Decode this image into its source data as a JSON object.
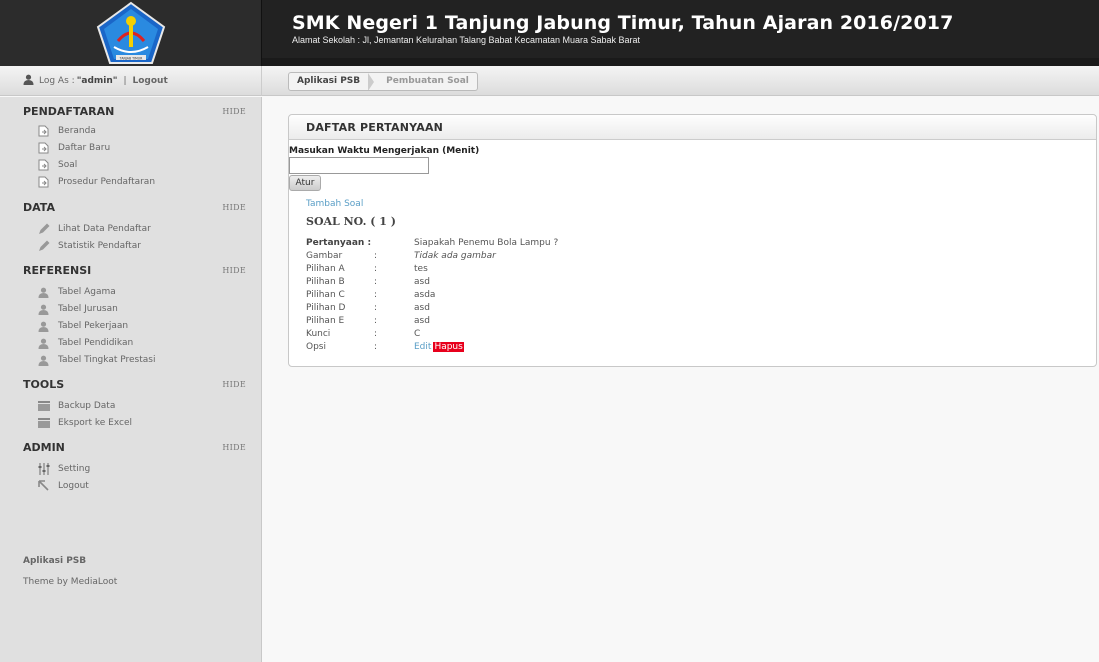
{
  "header": {
    "title": "SMK Negeri 1 Tanjung Jabung Timur, Tahun Ajaran 2016/2017",
    "subtitle": "Alamat Sekolah : Jl, Jemantan Kelurahan Talang Babat Kecamatan Muara Sabak Barat",
    "logo_text": "TANJAB TIMUR"
  },
  "user_bar": {
    "login_prefix": "Log As : ",
    "username": "\"admin\"",
    "separator": "|",
    "logout": "Logout"
  },
  "breadcrumbs": [
    "Aplikasi PSB",
    "Pembuatan Soal"
  ],
  "sidebar": {
    "sections": [
      {
        "title": "PENDAFTARAN",
        "hide": "HIDE",
        "items": [
          {
            "label": "Beranda",
            "icon": "page-icon"
          },
          {
            "label": "Daftar Baru",
            "icon": "page-icon"
          },
          {
            "label": "Soal",
            "icon": "page-icon"
          },
          {
            "label": "Prosedur Pendaftaran",
            "icon": "page-icon"
          }
        ]
      },
      {
        "title": "DATA",
        "hide": "HIDE",
        "items": [
          {
            "label": "Lihat Data Pendaftar",
            "icon": "pencil-icon"
          },
          {
            "label": "Statistik Pendaftar",
            "icon": "pencil-icon"
          }
        ]
      },
      {
        "title": "REFERENSI",
        "hide": "HIDE",
        "items": [
          {
            "label": "Tabel Agama",
            "icon": "user-icon"
          },
          {
            "label": "Tabel Jurusan",
            "icon": "user-icon"
          },
          {
            "label": "Tabel Pekerjaan",
            "icon": "user-icon"
          },
          {
            "label": "Tabel Pendidikan",
            "icon": "user-icon"
          },
          {
            "label": "Tabel Tingkat Prestasi",
            "icon": "user-icon"
          }
        ]
      },
      {
        "title": "TOOLS",
        "hide": "HIDE",
        "items": [
          {
            "label": "Backup Data",
            "icon": "folder-icon"
          },
          {
            "label": "Eksport ke Excel",
            "icon": "folder-icon"
          }
        ]
      },
      {
        "title": "ADMIN",
        "hide": "HIDE",
        "items": [
          {
            "label": "Setting",
            "icon": "sliders-icon"
          },
          {
            "label": "Logout",
            "icon": "arrow-icon"
          }
        ]
      }
    ],
    "footer_app": "Aplikasi PSB",
    "footer_theme": "Theme by MediaLoot"
  },
  "main": {
    "panel_title": "DAFTAR PERTANYAAN",
    "time_label": "Masukan Waktu Mengerjakan (Menit)",
    "time_value": "",
    "atur_label": "Atur",
    "add_link": "Tambah Soal",
    "soal_heading": "SOAL NO. ( 1 )",
    "rows": [
      {
        "key": "Pertanyaan :",
        "colon": "",
        "value": "Siapakah Penemu Bola Lampu ?",
        "bold": true
      },
      {
        "key": "Gambar",
        "colon": ":",
        "value": "Tidak ada gambar",
        "italic": true
      },
      {
        "key": "Pilihan A",
        "colon": ":",
        "value": "tes"
      },
      {
        "key": "Pilihan B",
        "colon": ":",
        "value": "asd"
      },
      {
        "key": "Pilihan C",
        "colon": ":",
        "value": "asda"
      },
      {
        "key": "Pilihan D",
        "colon": ":",
        "value": "asd"
      },
      {
        "key": "Pilihan E",
        "colon": ":",
        "value": "asd"
      },
      {
        "key": "Kunci",
        "colon": ":",
        "value": "C"
      }
    ],
    "opsi": {
      "key": "Opsi",
      "colon": ":",
      "edit": "Edit",
      "hapus": "Hapus"
    }
  },
  "colors": {
    "header_bg": "#222222",
    "link": "#5a9ec6",
    "danger": "#e8001c",
    "sidebar_bg": "#e0e0e0"
  }
}
